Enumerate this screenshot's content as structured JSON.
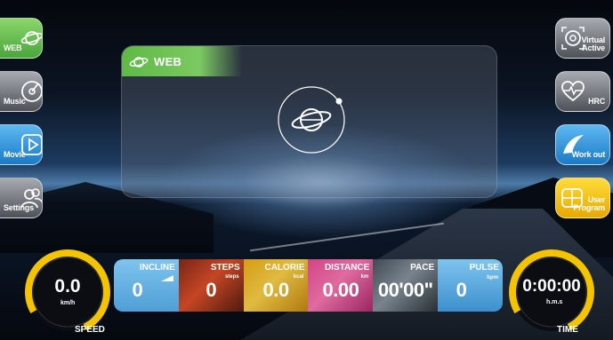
{
  "left_menu": [
    {
      "label": "WEB",
      "icon": "web-globe-icon",
      "color": "#5fb946"
    },
    {
      "label": "Music",
      "icon": "music-disc-icon",
      "color": "#6c7076"
    },
    {
      "label": "Movie",
      "icon": "movie-play-icon",
      "color": "#2f8fd6"
    },
    {
      "label": "Settings",
      "icon": "settings-users-icon",
      "color": "#6c7076"
    }
  ],
  "right_menu": [
    {
      "label_line1": "Virtual",
      "label_line2": "Active",
      "icon": "virtual-active-icon",
      "color": "#6c7076"
    },
    {
      "label_line1": "",
      "label_line2": "HRC",
      "icon": "heart-rate-icon",
      "color": "#6c7076"
    },
    {
      "label_line1": "",
      "label_line2": "Work out",
      "icon": "workout-icon",
      "color": "#2f8fd6"
    },
    {
      "label_line1": "User",
      "label_line2": "Program",
      "icon": "user-program-icon",
      "color": "#f0b400"
    }
  ],
  "panel": {
    "title": "WEB",
    "icon": "web-globe-icon"
  },
  "speed": {
    "value": "0.0",
    "unit": "km/h",
    "label": "SPEED",
    "accent": "#f5c400"
  },
  "time": {
    "value": "0:00:00",
    "unit": "h.m.s",
    "label": "TIME",
    "accent": "#f5c400"
  },
  "stats": [
    {
      "label": "INCLINE",
      "unit": "",
      "value": "0",
      "icon": "incline-icon"
    },
    {
      "label": "STEPS",
      "unit": "steps",
      "value": "0",
      "icon": "footprints-icon"
    },
    {
      "label": "CALORIE",
      "unit": "kcal",
      "value": "0.0",
      "icon": "flame-icon"
    },
    {
      "label": "DISTANCE",
      "unit": "km",
      "value": "0.00",
      "icon": "distance-icon"
    },
    {
      "label": "PACE",
      "unit": "",
      "value": "00'00\"",
      "icon": "pace-icon"
    },
    {
      "label": "PULSE",
      "unit": "bpm",
      "value": "0",
      "icon": "heart-icon"
    }
  ]
}
